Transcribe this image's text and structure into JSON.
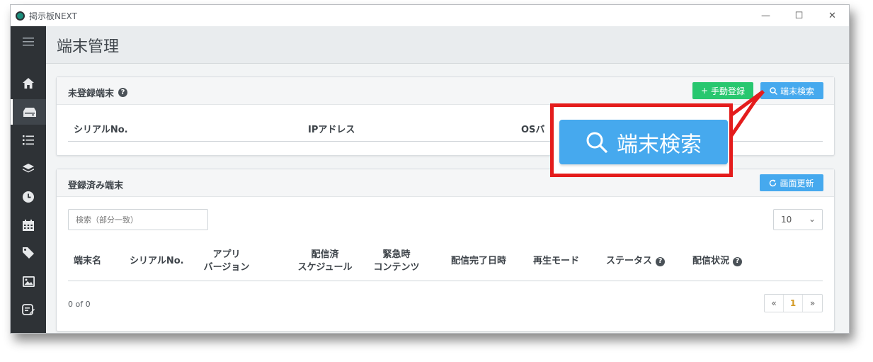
{
  "window": {
    "title": "掲示板NEXT",
    "controls": [
      "—",
      "☐",
      "✕"
    ]
  },
  "sidebar": {
    "items": [
      {
        "name": "menu-icon"
      },
      {
        "name": "home-icon"
      },
      {
        "name": "terminal-icon"
      },
      {
        "name": "list-icon"
      },
      {
        "name": "layers-icon"
      },
      {
        "name": "clock-icon"
      },
      {
        "name": "calendar-icon"
      },
      {
        "name": "tag-icon"
      },
      {
        "name": "image-icon"
      },
      {
        "name": "edit-icon"
      }
    ],
    "active_index": 2
  },
  "page": {
    "title": "端末管理"
  },
  "unregistered": {
    "title": "未登録端末",
    "manual_register_label": "手動登録",
    "search_label": "端末検索",
    "columns": [
      "シリアルNo.",
      "IPアドレス",
      "OSバ"
    ]
  },
  "registered": {
    "title": "登録済み端末",
    "refresh_label": "画面更新",
    "search_placeholder": "検索（部分一致）",
    "page_size": "10",
    "columns": {
      "name": "端末名",
      "serial": "シリアルNo.",
      "app_line1": "アプリ",
      "app_line2": "バージョン",
      "schedule_line1": "配信済",
      "schedule_line2": "スケジュール",
      "emergency_line1": "緊急時",
      "emergency_line2": "コンテンツ",
      "completed": "配信完了日時",
      "mode": "再生モード",
      "status": "ステータス",
      "delivery": "配信状況"
    },
    "count_text": "0 of 0",
    "pager": {
      "prev": "«",
      "current": "1",
      "next": "»"
    }
  },
  "callout": {
    "label": "端末検索"
  },
  "colors": {
    "accent_blue": "#46a9ee",
    "accent_green": "#28c76f",
    "callout_red": "#e41c1c",
    "sidebar": "#2e3236"
  }
}
